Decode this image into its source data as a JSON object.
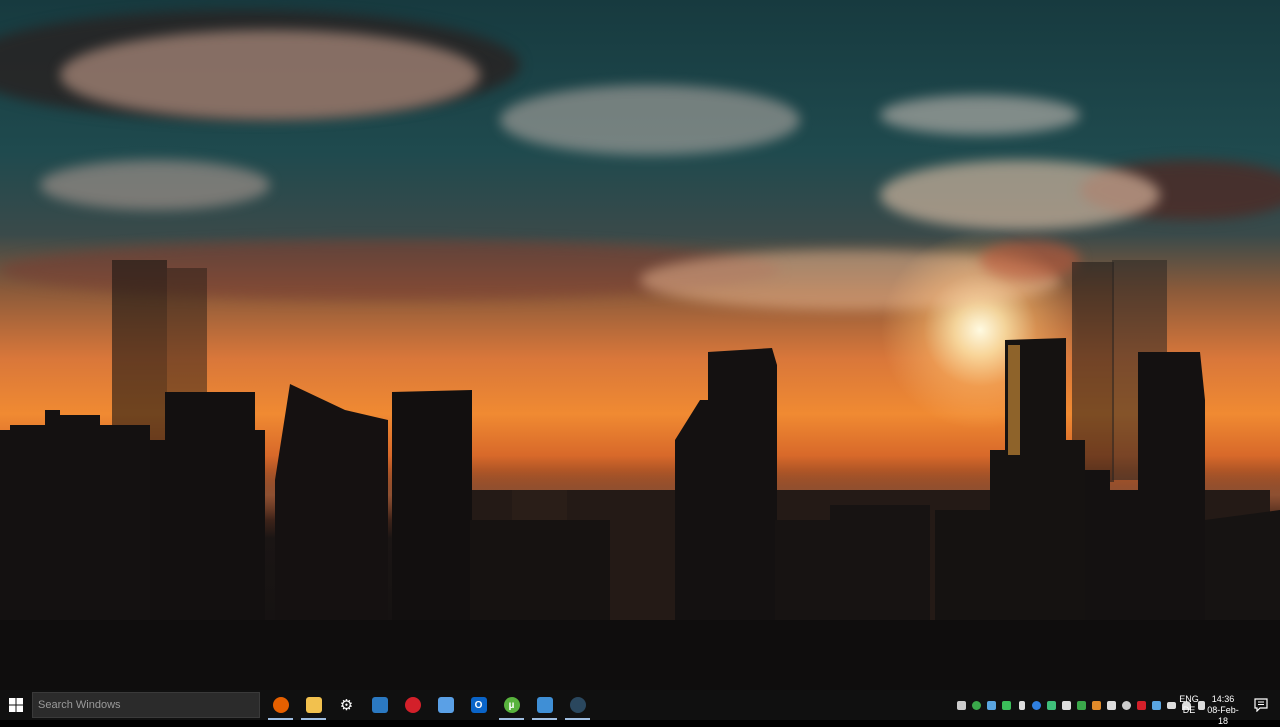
{
  "desktop": {
    "wallpaper": "city skyline silhouette at sunset"
  },
  "taskbar": {
    "start_icon": "windows-logo-icon",
    "search": {
      "placeholder": "Search Windows"
    },
    "pinned_apps": [
      {
        "name": "firefox-icon",
        "color": "#e66000",
        "glyph": ""
      },
      {
        "name": "file-explorer-icon",
        "color": "#f2c14e",
        "glyph": ""
      },
      {
        "name": "settings-gear-icon",
        "color": "#101010",
        "glyph": "⚙"
      },
      {
        "name": "remote-desktop-icon",
        "color": "#2b79c2",
        "glyph": ""
      },
      {
        "name": "red-app-icon",
        "color": "#d3202a",
        "glyph": ""
      },
      {
        "name": "chat-app-icon",
        "color": "#5aa0e6",
        "glyph": ""
      },
      {
        "name": "outlook-icon",
        "color": "#0a64c8",
        "glyph": "O"
      },
      {
        "name": "utorrent-icon",
        "color": "#58b33d",
        "glyph": "µ"
      },
      {
        "name": "blue-app-icon",
        "color": "#3f8fd6",
        "glyph": ""
      },
      {
        "name": "steam-icon",
        "color": "#1b2838",
        "glyph": ""
      }
    ],
    "tray_icons": [
      {
        "name": "shield-icon",
        "color": "#cccccc"
      },
      {
        "name": "green-circle-icon",
        "color": "#3aa84a"
      },
      {
        "name": "cloud-sync-icon",
        "color": "#5aa5e0"
      },
      {
        "name": "green-app-icon",
        "color": "#3bbf5a"
      },
      {
        "name": "usb-drive-icon",
        "color": "#dddddd"
      },
      {
        "name": "bluetooth-icon",
        "color": "#2f7fe0"
      },
      {
        "name": "network-cross-icon",
        "color": "#3fbf7a"
      },
      {
        "name": "k-app-icon",
        "color": "#dddddd"
      },
      {
        "name": "green-square-icon",
        "color": "#3aa84a"
      },
      {
        "name": "orange-app-icon",
        "color": "#e08a2a"
      },
      {
        "name": "printer-icon",
        "color": "#dddddd"
      },
      {
        "name": "steam-tray-icon",
        "color": "#cccccc"
      },
      {
        "name": "red-tray-icon",
        "color": "#d3202a"
      },
      {
        "name": "check-shield-icon",
        "color": "#5aa5e0"
      },
      {
        "name": "monitor-icon",
        "color": "#dddddd"
      },
      {
        "name": "wifi-icon",
        "color": "#dddddd"
      },
      {
        "name": "volume-icon",
        "color": "#dddddd"
      }
    ],
    "language": {
      "line1": "ENG",
      "line2": "DE"
    },
    "clock": {
      "time": "14:36",
      "date": "08-Feb-18"
    },
    "notification_icon": "action-center-icon"
  }
}
